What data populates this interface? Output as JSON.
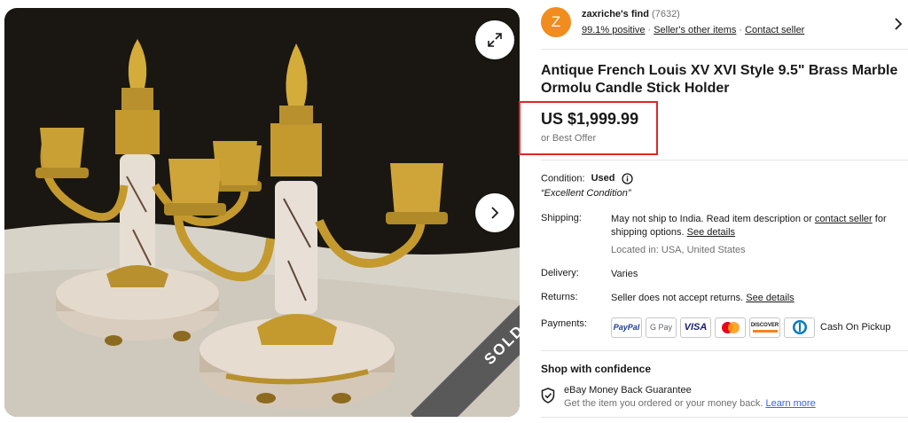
{
  "gallery": {
    "sold_label": "SOLD",
    "expand_icon": "expand-icon",
    "next_icon": "chevron-right-icon"
  },
  "seller": {
    "avatar_letter": "Z",
    "name": "zaxriche's find",
    "feedback_count": "(7632)",
    "positive": "99.1% positive",
    "other_items": "Seller's other items",
    "contact": "Contact seller"
  },
  "listing": {
    "title": "Antique French Louis XV XVI Style 9.5\" Brass Marble Ormolu Candle Stick Holder",
    "price": "US $1,999.99",
    "best_offer": "or Best Offer"
  },
  "details": {
    "condition_label": "Condition:",
    "condition_value": "Used",
    "condition_desc": "“Excellent Condition”",
    "shipping_label": "Shipping:",
    "shipping_text_1": "May not ship to India. Read item description or ",
    "shipping_contact_link": "contact seller",
    "shipping_text_2": " for shipping options. ",
    "shipping_details_link": "See details",
    "located": "Located in: USA, United States",
    "delivery_label": "Delivery:",
    "delivery_value": "Varies",
    "returns_label": "Returns:",
    "returns_value": "Seller does not accept returns. ",
    "returns_link": "See details",
    "payments_label": "Payments:",
    "payments": [
      "PayPal",
      "G Pay",
      "VISA",
      "Mastercard",
      "DISCOVER",
      "Diners Club"
    ],
    "cash_on_pickup": "Cash On Pickup"
  },
  "confidence": {
    "title": "Shop with confidence",
    "guarantee_title": "eBay Money Back Guarantee",
    "guarantee_desc": "Get the item you ordered or your money back. ",
    "learn_more": "Learn more"
  },
  "colors": {
    "avatar": "#f18c1e",
    "highlight_box": "#e0262a",
    "link_blue": "#3665f3",
    "sold_ribbon": "#595959"
  }
}
